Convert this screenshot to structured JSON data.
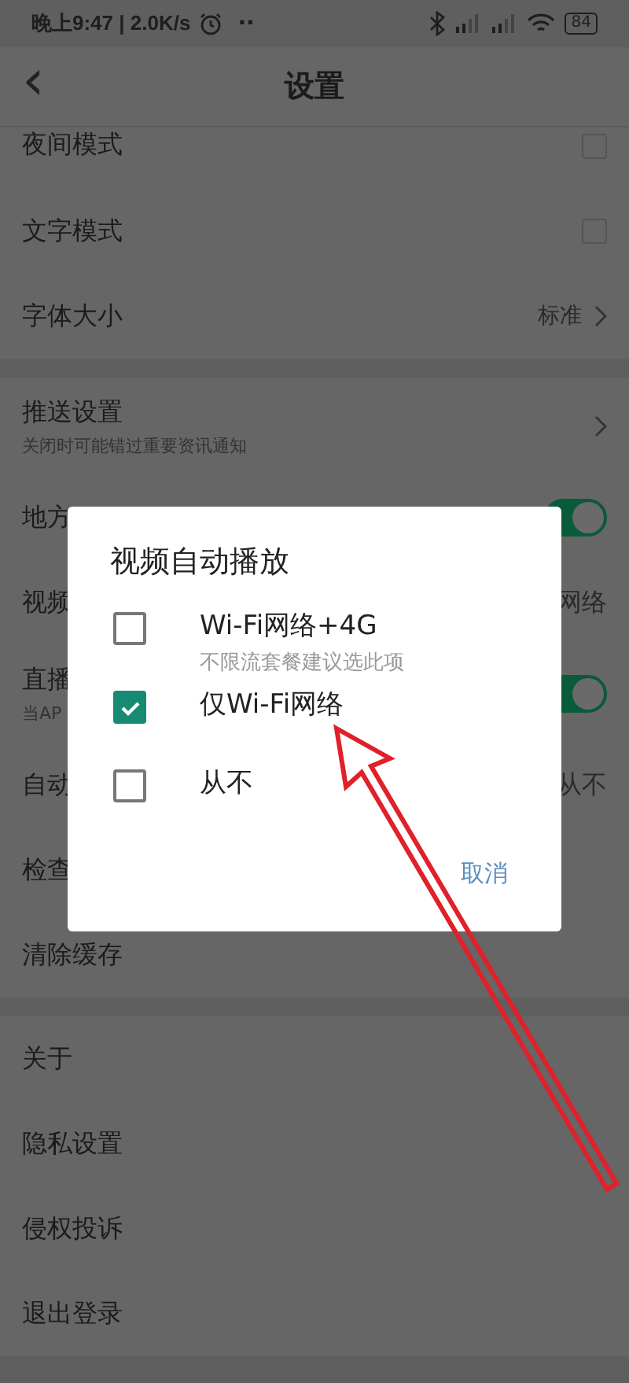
{
  "status_bar": {
    "time": "晚上9:47 | 2.0K/s",
    "dots": "··",
    "battery": "84"
  },
  "header": {
    "back": "‹",
    "title": "设置"
  },
  "groups": [
    {
      "items": [
        {
          "kind": "checkbox",
          "label": "夜间模式",
          "checked": false
        },
        {
          "kind": "checkbox",
          "label": "文字模式",
          "checked": false
        },
        {
          "kind": "value",
          "label": "字体大小",
          "value": "标准"
        }
      ]
    },
    {
      "items": [
        {
          "kind": "link",
          "label": "推送设置",
          "subtitle": "关闭时可能错过重要资讯通知"
        },
        {
          "kind": "toggle",
          "label": "地方",
          "on": true
        },
        {
          "kind": "text",
          "label": "视频",
          "value": "网络"
        },
        {
          "kind": "toggle",
          "label": "直播",
          "subtitle": "当AP",
          "on": true
        },
        {
          "kind": "text",
          "label": "自动",
          "value": "从不"
        },
        {
          "kind": "plain",
          "label": "检查"
        },
        {
          "kind": "plain",
          "label": "清除缓存"
        }
      ]
    },
    {
      "items": [
        {
          "kind": "plain",
          "label": "关于"
        },
        {
          "kind": "plain",
          "label": "隐私设置"
        },
        {
          "kind": "plain",
          "label": "侵权投诉"
        },
        {
          "kind": "plain",
          "label": "退出登录"
        }
      ]
    }
  ],
  "dialog": {
    "title": "视频自动播放",
    "options": [
      {
        "label": "Wi-Fi网络+4G",
        "hint": "不限流套餐建议选此项",
        "selected": false
      },
      {
        "label": "仅Wi-Fi网络",
        "selected": true
      },
      {
        "label": "从不",
        "selected": false
      }
    ],
    "cancel": "取消"
  }
}
